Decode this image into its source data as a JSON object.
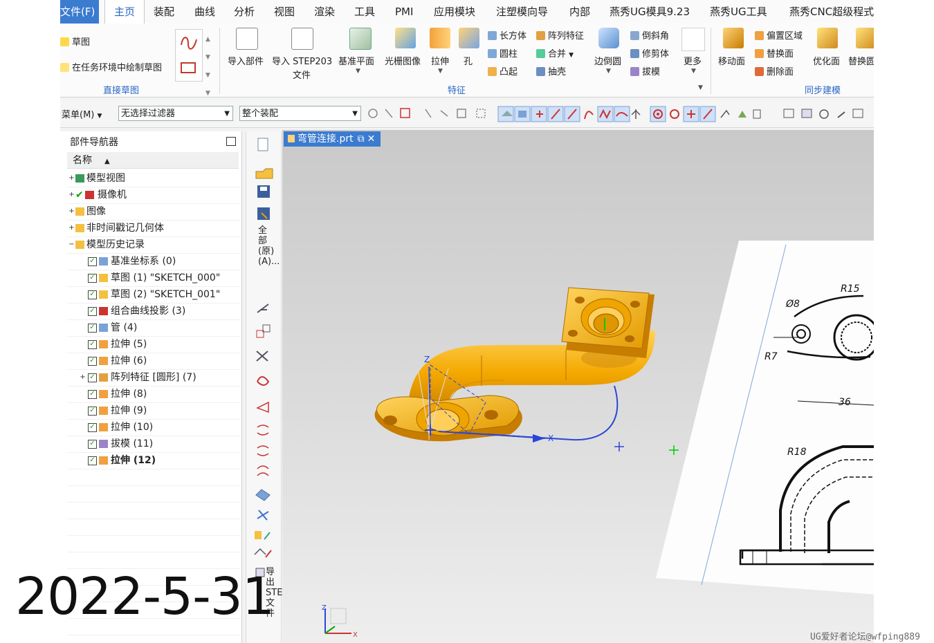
{
  "menu": {
    "items": [
      "文件(F)",
      "主页",
      "装配",
      "曲线",
      "分析",
      "视图",
      "渲染",
      "工具",
      "PMI",
      "应用模块",
      "注塑模向导",
      "内部",
      "燕秀UG模具9.23",
      "燕秀UG工具",
      "燕秀CNC超级程式"
    ],
    "active": "主页"
  },
  "ribbon": {
    "sketch": "草图",
    "sketch_task": "在任务环境中绘制草图",
    "direct_sketch": "直接草图",
    "import_part": "导入部件",
    "import_step": "导入 STEP203",
    "import_step2": "文件",
    "datum_plane": "基准平面",
    "raster_image": "光栅图像",
    "extrude": "拉伸",
    "hole": "孔",
    "block": "长方体",
    "cylinder": "圆柱",
    "boss": "凸起",
    "pattern": "阵列特征",
    "unite": "合并",
    "shell": "抽壳",
    "edge_blend": "边倒圆",
    "chamfer": "倒斜角",
    "trim_body": "修剪体",
    "draft": "拔模",
    "more": "更多",
    "feature_group": "特征",
    "move_face": "移动面",
    "offset_region": "偏置区域",
    "replace_face": "替换面",
    "delete_face": "删除面",
    "optimize_face": "优化面",
    "replace_blend": "替换圆",
    "sync_group": "同步建模"
  },
  "toolbar": {
    "menu": "菜单(M)",
    "filter": "无选择过滤器",
    "scope": "整个装配"
  },
  "navigator": {
    "title": "部件导航器",
    "column": "名称",
    "rows": [
      {
        "label": "模型视图",
        "level": 0,
        "type": "folder"
      },
      {
        "label": "摄像机",
        "level": 0,
        "type": "camera"
      },
      {
        "label": "图像",
        "level": 0,
        "type": "folder"
      },
      {
        "label": "非时间戳记几何体",
        "level": 0,
        "type": "folder"
      },
      {
        "label": "模型历史记录",
        "level": 0,
        "type": "folder"
      },
      {
        "label": "基准坐标系 (0)",
        "level": 1
      },
      {
        "label": "草图 (1) \"SKETCH_000\"",
        "level": 1
      },
      {
        "label": "草图 (2) \"SKETCH_001\"",
        "level": 1
      },
      {
        "label": "组合曲线投影 (3)",
        "level": 1
      },
      {
        "label": "管 (4)",
        "level": 1
      },
      {
        "label": "拉伸 (5)",
        "level": 1
      },
      {
        "label": "拉伸 (6)",
        "level": 1
      },
      {
        "label": "阵列特征 [圆形] (7)",
        "level": 1
      },
      {
        "label": "拉伸 (8)",
        "level": 1
      },
      {
        "label": "拉伸 (9)",
        "level": 1
      },
      {
        "label": "拉伸 (10)",
        "level": 1
      },
      {
        "label": "拔模 (11)",
        "level": 1
      },
      {
        "label": "拉伸 (12)",
        "level": 1
      }
    ]
  },
  "resource_bar": {
    "label_all": "全部 (原) (A)...",
    "label_export": "导出 STEP 文件"
  },
  "graphics": {
    "tab": "弯管连接.prt",
    "drawing_dims": [
      "R15",
      "Ø8",
      "R7",
      "36",
      "R18"
    ]
  },
  "overlay": {
    "date": "2022-5-31",
    "watermark": "UG爱好者论坛@wfping889"
  },
  "colors": {
    "accent": "#3b7bd0",
    "part": "#f4a900",
    "part_dark": "#c77d00"
  }
}
